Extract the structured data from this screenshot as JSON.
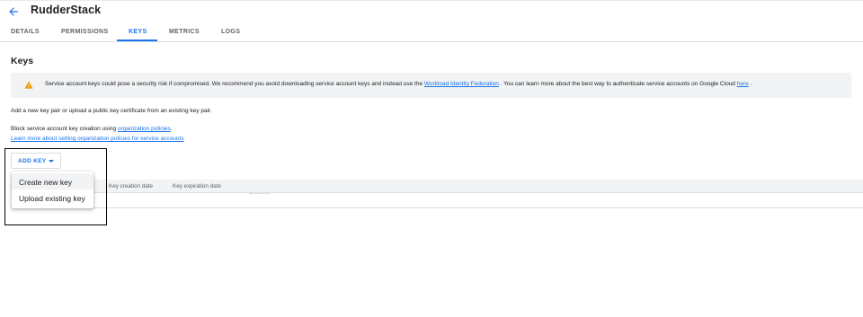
{
  "header": {
    "title": "RudderStack",
    "back_icon": "arrow-back-icon"
  },
  "tabs": [
    {
      "label": "DETAILS",
      "active": false
    },
    {
      "label": "PERMISSIONS",
      "active": false
    },
    {
      "label": "KEYS",
      "active": true
    },
    {
      "label": "METRICS",
      "active": false
    },
    {
      "label": "LOGS",
      "active": false
    }
  ],
  "section": {
    "title": "Keys"
  },
  "warning": {
    "icon": "warning-icon",
    "text_before": "Service account keys could pose a security risk if compromised. We recommend you avoid downloading service account keys and instead use the ",
    "link1": "Workload Identity Federation",
    "text_middle": " . You can learn more about the best way to authenticate service accounts on Google Cloud ",
    "link2": "here",
    "text_after": " ."
  },
  "info": {
    "add_key_text": "Add a new key pair or upload a public key certificate from an existing key pair.",
    "block_text": "Block service account key creation using ",
    "org_policies_link": "organization policies",
    "block_text_end": ".",
    "learn_more_link": "Learn more about setting organization policies for service accounts"
  },
  "add_key_button": {
    "label": "ADD KEY",
    "icon": "caret-down-icon"
  },
  "dropdown_menu": {
    "items": [
      "Create new key",
      "Upload existing key"
    ]
  },
  "table": {
    "columns": [
      "Key creation date",
      "Key expiration date"
    ]
  },
  "colors": {
    "accent": "#1a73e8",
    "warning": "#f29900",
    "panel_bg": "#f1f3f4"
  }
}
